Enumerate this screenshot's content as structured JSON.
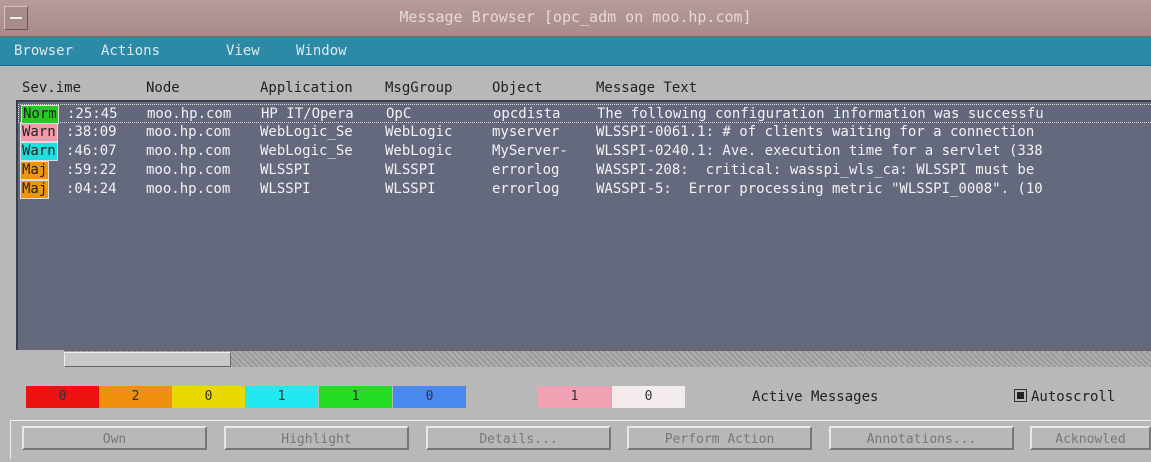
{
  "window": {
    "title": "Message Browser  [opc_adm on moo.hp.com]"
  },
  "menu": [
    "Browser",
    "Actions",
    "View",
    "Window"
  ],
  "columns": [
    "Sev.ime",
    "Node",
    "Application",
    "MsgGroup",
    "Object",
    "Message Text"
  ],
  "rows": [
    {
      "sev": "Norm",
      "sev_color": "#22cc22",
      "time": ":25:45",
      "node": "moo.hp.com",
      "app": "HP IT/Opera",
      "group": "OpC",
      "object": "opcdista",
      "text": "The following configuration information was successfu"
    },
    {
      "sev": "Warn",
      "sev_color": "#f29aaa",
      "time": ":38:09",
      "node": "moo.hp.com",
      "app": "WebLogic_Se",
      "group": "WebLogic",
      "object": "myserver",
      "text": "WLSSPI-0061.1: # of clients waiting for a connection"
    },
    {
      "sev": "Warn",
      "sev_color": "#22dddd",
      "time": ":46:07",
      "node": "moo.hp.com",
      "app": "WebLogic_Se",
      "group": "WebLogic",
      "object": "MyServer-",
      "text": "WLSSPI-0240.1: Ave. execution time for a servlet (338"
    },
    {
      "sev": "Maj",
      "sev_color": "#f0940e",
      "time": ":59:22",
      "node": "moo.hp.com",
      "app": "WLSSPI",
      "group": "WLSSPI",
      "object": "errorlog",
      "text": "WASSPI-208:  critical: wasspi_wls_ca: WLSSPI must be"
    },
    {
      "sev": "Maj",
      "sev_color": "#f0940e",
      "time": ":04:24",
      "node": "moo.hp.com",
      "app": "WLSSPI",
      "group": "WLSSPI",
      "object": "errorlog",
      "text": "WASSPI-5:  Error processing metric \"WLSSPI_0008\". (10"
    }
  ],
  "counters": [
    {
      "value": "0",
      "color": "#ee1111"
    },
    {
      "value": "2",
      "color": "#f0900e"
    },
    {
      "value": "0",
      "color": "#e8d800"
    },
    {
      "value": "1",
      "color": "#22e8f0"
    },
    {
      "value": "1",
      "color": "#22dd22"
    },
    {
      "value": "0",
      "color": "#4a8af0"
    },
    {
      "value": "1",
      "color": "#f2a0b4"
    },
    {
      "value": "0",
      "color": "#f4ecec"
    }
  ],
  "active_messages_label": "Active Messages",
  "autoscroll_label": "Autoscroll",
  "buttons": [
    "Own",
    "Highlight",
    "Details...",
    "Perform Action",
    "Annotations...",
    "Acknowled"
  ]
}
